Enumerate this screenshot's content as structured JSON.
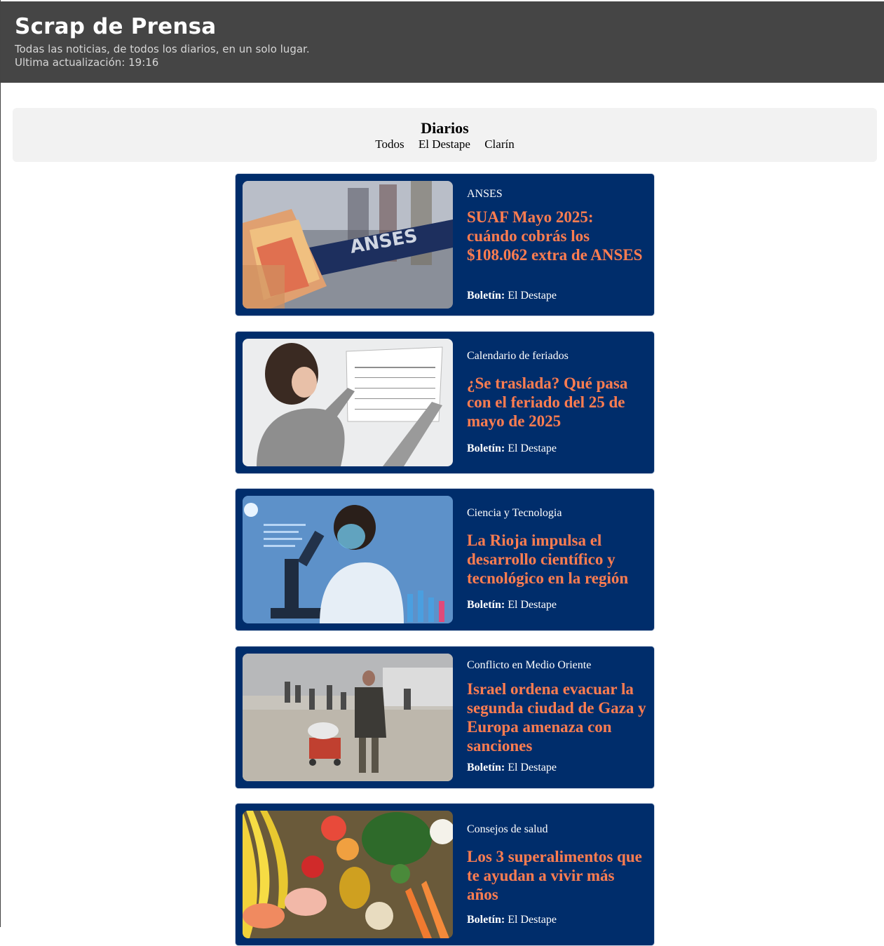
{
  "header": {
    "title": "Scrap de Prensa",
    "subtitle": "Todas las noticias, de todos los diarios, en un solo lugar.",
    "updated": "Ultima actualización: 19:16"
  },
  "filters": {
    "title": "Diarios",
    "options": [
      "Todos",
      "El Destape",
      "Clarín"
    ]
  },
  "articles": [
    {
      "category": "ANSES",
      "headline": "SUAF Mayo 2025: cuándo cobrás los $108.062 extra de ANSES",
      "source_label": "Boletín:",
      "source": "El Destape",
      "image_icon": "anses-banner-money-image"
    },
    {
      "category": "Calendario de feriados",
      "headline": "¿Se traslada? Qué pasa con el feriado del 25 de mayo de 2025",
      "source_label": "Boletín:",
      "source": "El Destape",
      "image_icon": "woman-calendar-image"
    },
    {
      "category": "Ciencia y Tecnologia",
      "headline": "La Rioja impulsa el desarrollo científico y tecnológico en la región",
      "source_label": "Boletín:",
      "source": "El Destape",
      "image_icon": "scientist-microscope-image"
    },
    {
      "category": "Conflicto en Medio Oriente",
      "headline": "Israel ordena evacuar la segunda ciudad de Gaza y Europa amenaza con sanciones",
      "source_label": "Boletín:",
      "source": "El Destape",
      "image_icon": "gaza-evacuation-image"
    },
    {
      "category": "Consejos de salud",
      "headline": "Los 3 superalimentos que te ayudan a vivir más años",
      "source_label": "Boletín:",
      "source": "El Destape",
      "image_icon": "healthy-food-image"
    }
  ],
  "colors": {
    "header_bg": "#454545",
    "card_bg": "#002d6b",
    "headline": "#ff7d50",
    "filter_bg": "#f2f2f2"
  }
}
